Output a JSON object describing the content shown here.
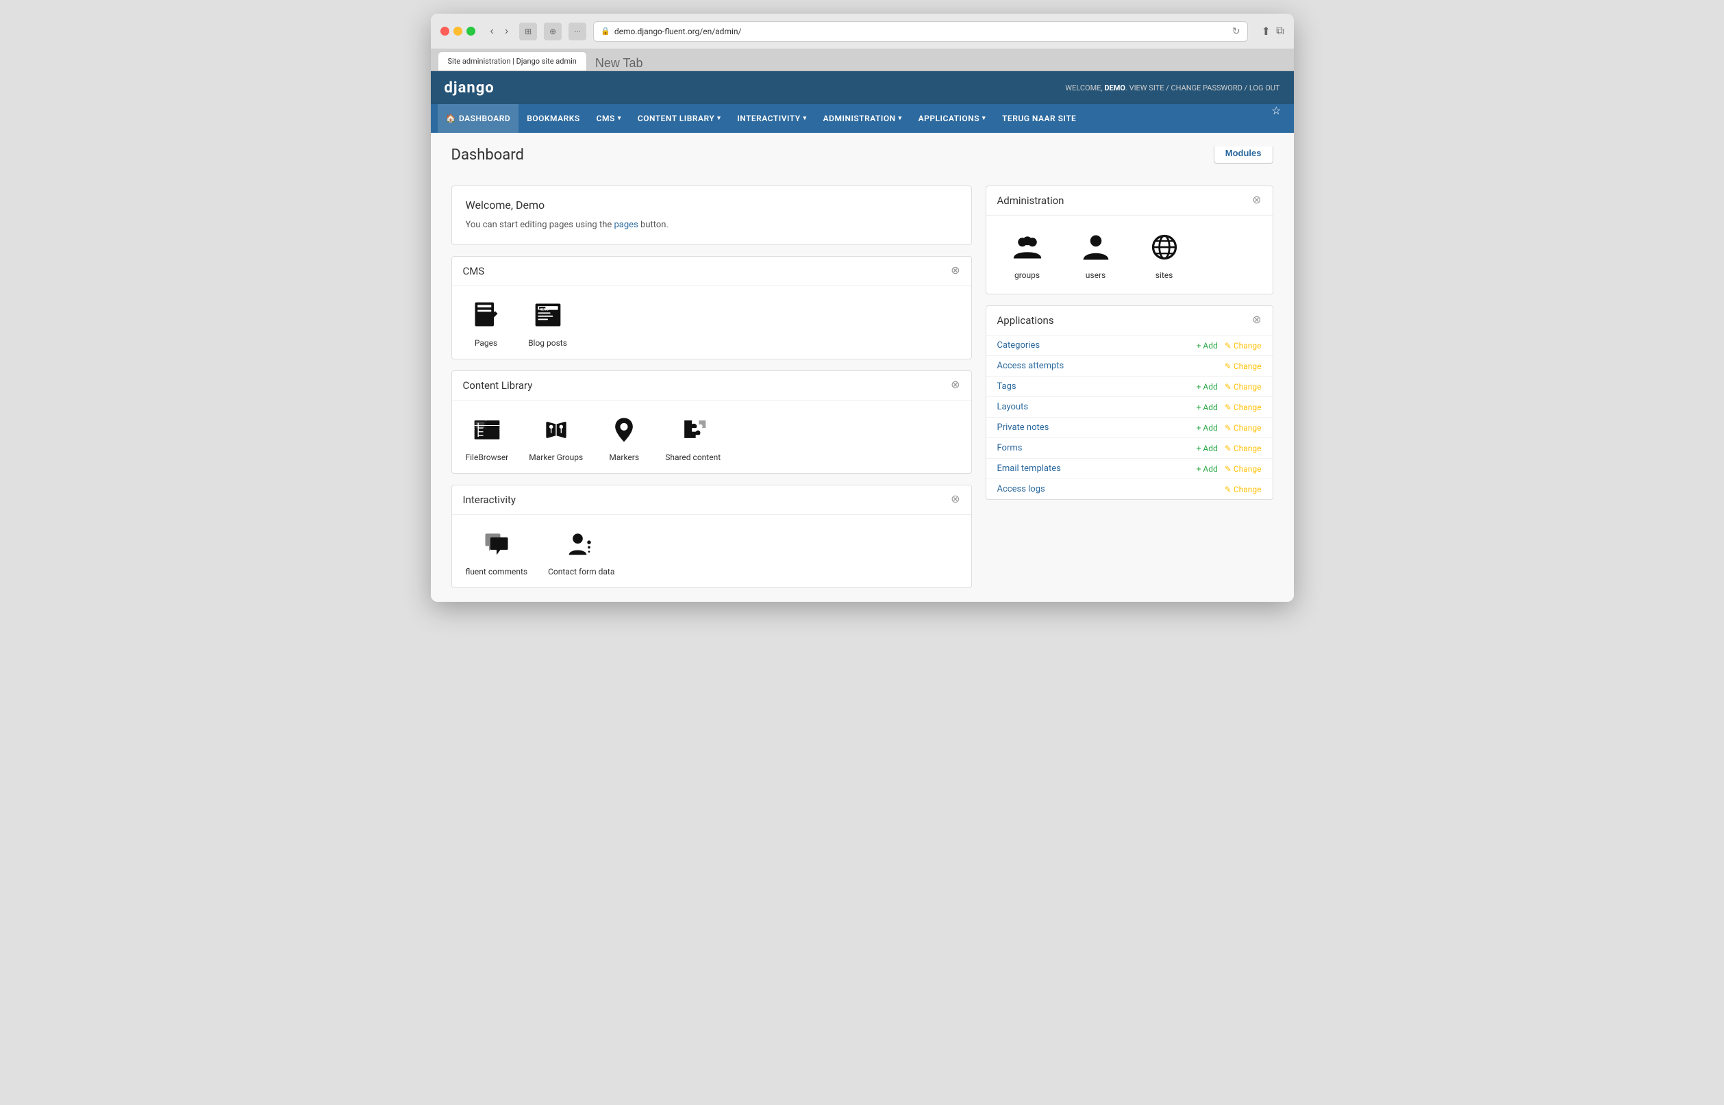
{
  "browser": {
    "tab_title": "Site administration | Django site admin",
    "url": "demo.django-fluent.org/en/admin/",
    "new_tab_tooltip": "New Tab"
  },
  "header": {
    "logo": "django",
    "welcome_prefix": "WELCOME,",
    "username": "DEMO",
    "view_site": "VIEW SITE",
    "change_password": "CHANGE PASSWORD",
    "log_out": "LOG OUT"
  },
  "nav": {
    "items": [
      {
        "id": "dashboard",
        "label": "DASHBOARD",
        "has_dropdown": false,
        "active": true,
        "icon": "home"
      },
      {
        "id": "bookmarks",
        "label": "BOOKMARKS",
        "has_dropdown": false
      },
      {
        "id": "cms",
        "label": "CMS",
        "has_dropdown": true
      },
      {
        "id": "content-library",
        "label": "CONTENT LIBRARY",
        "has_dropdown": true
      },
      {
        "id": "interactivity",
        "label": "INTERACTIVITY",
        "has_dropdown": true
      },
      {
        "id": "administration",
        "label": "ADMINISTRATION",
        "has_dropdown": true
      },
      {
        "id": "applications",
        "label": "APPLICATIONS",
        "has_dropdown": true
      },
      {
        "id": "terug",
        "label": "TERUG NAAR SITE",
        "has_dropdown": false
      }
    ]
  },
  "page": {
    "title": "Dashboard",
    "modules_button": "Modules"
  },
  "welcome_section": {
    "title": "Welcome, Demo",
    "text_before_link": "You can start editing pages using the",
    "link_text": "pages",
    "text_after_link": "button."
  },
  "cms_section": {
    "title": "CMS",
    "items": [
      {
        "id": "pages",
        "label": "Pages"
      },
      {
        "id": "blog-posts",
        "label": "Blog posts"
      }
    ]
  },
  "content_library_section": {
    "title": "Content Library",
    "items": [
      {
        "id": "filebrowser",
        "label": "FileBrowser"
      },
      {
        "id": "marker-groups",
        "label": "Marker Groups"
      },
      {
        "id": "markers",
        "label": "Markers"
      },
      {
        "id": "shared-content",
        "label": "Shared content"
      }
    ]
  },
  "interactivity_section": {
    "title": "Interactivity",
    "items": [
      {
        "id": "fluent-comments",
        "label": "fluent comments"
      },
      {
        "id": "contact-form-data",
        "label": "Contact form data"
      }
    ]
  },
  "administration_section": {
    "title": "Administration",
    "items": [
      {
        "id": "groups",
        "label": "groups"
      },
      {
        "id": "users",
        "label": "users"
      },
      {
        "id": "sites",
        "label": "sites"
      }
    ]
  },
  "applications_section": {
    "title": "Applications",
    "rows": [
      {
        "id": "categories",
        "name": "Categories",
        "has_add": true,
        "has_change": true,
        "add_label": "+ Add",
        "change_label": "✎ Change"
      },
      {
        "id": "access-attempts",
        "name": "Access attempts",
        "has_add": false,
        "has_change": true,
        "add_label": "",
        "change_label": "✎ Change"
      },
      {
        "id": "tags",
        "name": "Tags",
        "has_add": true,
        "has_change": true,
        "add_label": "+ Add",
        "change_label": "✎ Change"
      },
      {
        "id": "layouts",
        "name": "Layouts",
        "has_add": true,
        "has_change": true,
        "add_label": "+ Add",
        "change_label": "✎ Change"
      },
      {
        "id": "private-notes",
        "name": "Private notes",
        "has_add": true,
        "has_change": true,
        "add_label": "+ Add",
        "change_label": "✎ Change"
      },
      {
        "id": "forms",
        "name": "Forms",
        "has_add": true,
        "has_change": true,
        "add_label": "+ Add",
        "change_label": "✎ Change"
      },
      {
        "id": "email-templates",
        "name": "Email templates",
        "has_add": true,
        "has_change": true,
        "add_label": "+ Add",
        "change_label": "✎ Change"
      },
      {
        "id": "access-logs",
        "name": "Access logs",
        "has_add": false,
        "has_change": true,
        "add_label": "",
        "change_label": "✎ Change"
      }
    ]
  },
  "colors": {
    "header_bg": "#265476",
    "nav_bg": "#2d6a9f",
    "link": "#2d6a9f",
    "add": "#28a745",
    "change": "#ffc107"
  }
}
